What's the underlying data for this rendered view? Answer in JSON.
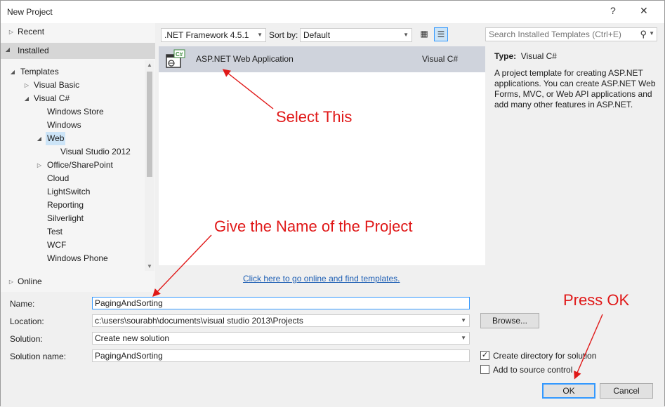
{
  "window": {
    "title": "New Project"
  },
  "titlebar": {
    "help": "?",
    "close": "✕"
  },
  "sidebar": {
    "recent": "Recent",
    "installed": "Installed",
    "templates": "Templates",
    "items": [
      {
        "label": "Visual Basic"
      },
      {
        "label": "Visual C#"
      },
      {
        "label": "Windows Store"
      },
      {
        "label": "Windows"
      },
      {
        "label": "Web"
      },
      {
        "label": "Visual Studio 2012"
      },
      {
        "label": "Office/SharePoint"
      },
      {
        "label": "Cloud"
      },
      {
        "label": "LightSwitch"
      },
      {
        "label": "Reporting"
      },
      {
        "label": "Silverlight"
      },
      {
        "label": "Test"
      },
      {
        "label": "WCF"
      },
      {
        "label": "Windows Phone"
      }
    ],
    "online": "Online"
  },
  "toolbar": {
    "framework": ".NET Framework 4.5.1",
    "sort_label": "Sort by:",
    "sort_value": "Default"
  },
  "search": {
    "placeholder": "Search Installed Templates (Ctrl+E)"
  },
  "templates": [
    {
      "name": "ASP.NET Web Application",
      "language": "Visual C#",
      "icon": "aspnet-web-icon",
      "badge": "C#"
    }
  ],
  "details": {
    "type_label": "Type:",
    "type_value": "Visual C#",
    "description": "A project template for creating ASP.NET applications. You can create ASP.NET Web Forms, MVC,  or Web API applications and add many other features in ASP.NET."
  },
  "online_link": "Click here to go online and find templates.",
  "form": {
    "name_label": "Name:",
    "name_value": "PagingAndSorting",
    "location_label": "Location:",
    "location_value": "c:\\users\\sourabh\\documents\\visual studio 2013\\Projects",
    "browse_label": "Browse...",
    "solution_label": "Solution:",
    "solution_value": "Create new solution",
    "solution_name_label": "Solution name:",
    "solution_name_value": "PagingAndSorting",
    "create_dir_label": "Create directory for solution",
    "create_dir_checked": true,
    "source_control_label": "Add to source control",
    "source_control_checked": false
  },
  "buttons": {
    "ok": "OK",
    "cancel": "Cancel"
  },
  "annotations": {
    "select_this": "Select This",
    "give_name": "Give the Name of the Project",
    "press_ok": "Press OK",
    "color": "#e01818"
  }
}
